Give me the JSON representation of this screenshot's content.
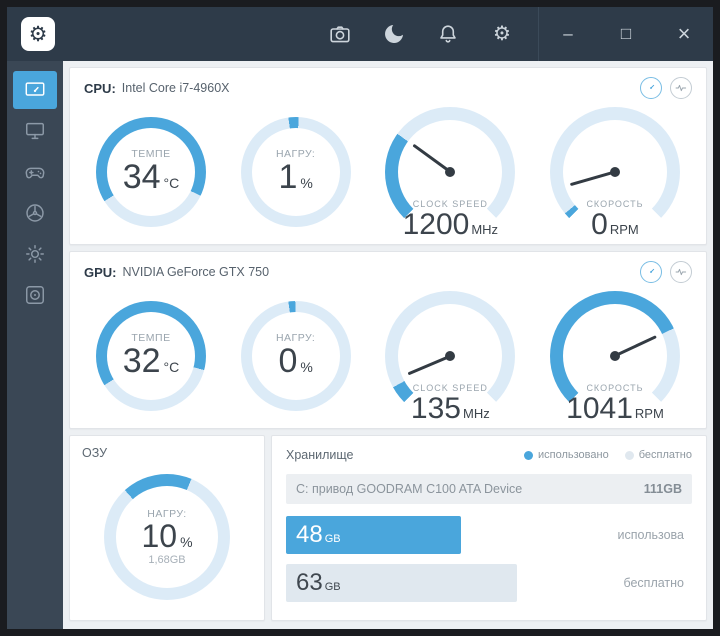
{
  "colors": {
    "accent": "#4aa6dc",
    "track": "#dcebf7",
    "needle": "#333b43",
    "free_bar": "#e0e8ef"
  },
  "titlebar": {
    "logo_glyph": "⚙",
    "gear_glyph": "⚙",
    "controls": {
      "minimize": "–",
      "maximize": "□",
      "close": "×"
    }
  },
  "sidebar": {
    "items": [
      {
        "id": "monitoring",
        "active": true
      },
      {
        "id": "pc-specs",
        "active": false
      },
      {
        "id": "games",
        "active": false
      },
      {
        "id": "cooling",
        "active": false
      },
      {
        "id": "lighting",
        "active": false
      },
      {
        "id": "camera",
        "active": false
      }
    ]
  },
  "cpu_panel": {
    "label": "CPU:",
    "device": "Intel Core i7-4960X",
    "gauges": [
      {
        "type": "ring",
        "label": "ТЕМПЕ",
        "value": "34",
        "unit": "°C",
        "pct": 66,
        "start": 238
      },
      {
        "type": "ring",
        "label": "НАГРУ:",
        "value": "1",
        "unit": "%",
        "pct": 3,
        "start": 352
      },
      {
        "type": "dial",
        "label": "CLOCK SPEED",
        "value": "1200",
        "unit": "MHz",
        "arc": 30,
        "needle": 306
      },
      {
        "type": "dial",
        "label": "СКОРОСТЬ",
        "value": "0",
        "unit": "RPM",
        "arc": 2,
        "needle": 254
      }
    ]
  },
  "gpu_panel": {
    "label": "GPU:",
    "device": "NVIDIA GeForce GTX 750",
    "gauges": [
      {
        "type": "ring",
        "label": "ТЕМПЕ",
        "value": "32",
        "unit": "°C",
        "pct": 63,
        "start": 238
      },
      {
        "type": "ring",
        "label": "НАГРУ:",
        "value": "0",
        "unit": "%",
        "pct": 2,
        "start": 352
      },
      {
        "type": "dial",
        "label": "CLOCK SPEED",
        "value": "135",
        "unit": "MHz",
        "arc": 6,
        "needle": 247
      },
      {
        "type": "dial",
        "label": "СКОРОСТЬ",
        "value": "1041",
        "unit": "RPM",
        "arc": 74,
        "needle": 65
      }
    ]
  },
  "ram_panel": {
    "title": "ОЗУ",
    "gauge": {
      "type": "ring",
      "label": "НАГРУ:",
      "value": "10",
      "unit": "%",
      "sub": "1,68GB",
      "pct": 18,
      "start": 318
    }
  },
  "storage_panel": {
    "title": "Хранилище",
    "legend": [
      {
        "label": "использовано"
      },
      {
        "label": "бесплатно"
      }
    ],
    "drive": {
      "name": "C: привод GOODRAM C100 ATA Device",
      "size": "111GB"
    },
    "bars": [
      {
        "value": "48",
        "unit": "GB",
        "label": "использова",
        "percent": 43,
        "kind": "used"
      },
      {
        "value": "63",
        "unit": "GB",
        "label": "бесплатно",
        "percent": 57,
        "kind": "free"
      }
    ]
  }
}
